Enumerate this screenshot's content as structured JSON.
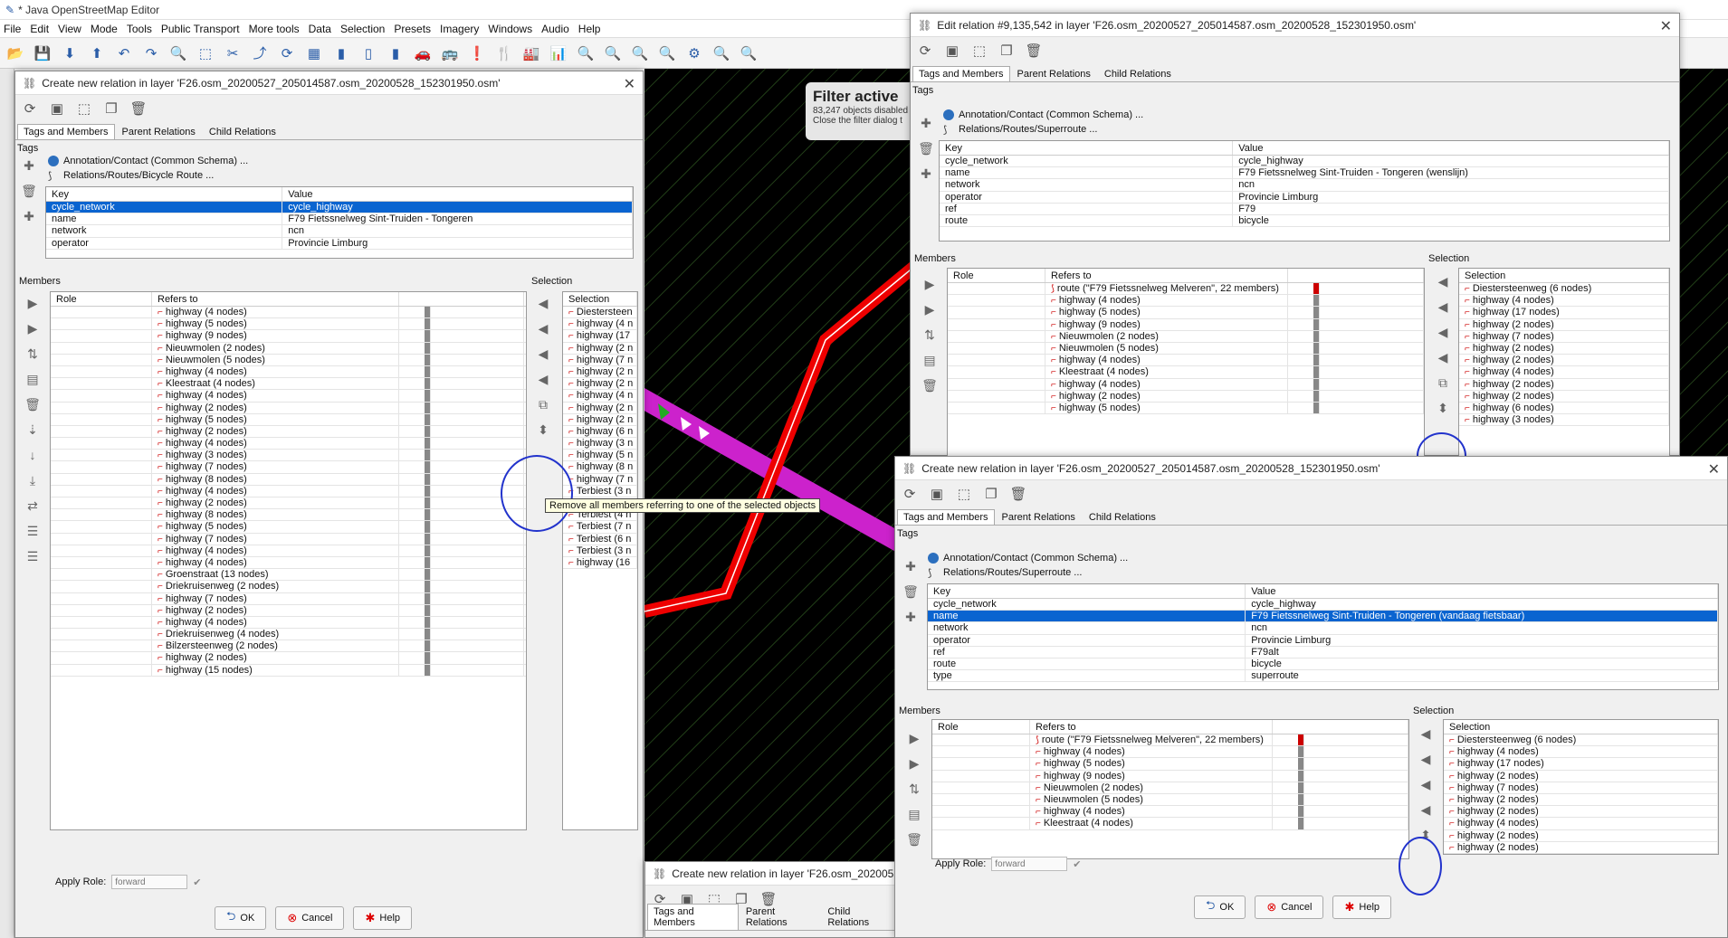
{
  "app": {
    "title": "* Java OpenStreetMap Editor"
  },
  "menu": [
    "File",
    "Edit",
    "View",
    "Mode",
    "Tools",
    "Public Transport",
    "More tools",
    "Data",
    "Selection",
    "Presets",
    "Imagery",
    "Windows",
    "Audio",
    "Help"
  ],
  "map": {
    "filter_title": "Filter active",
    "filter_line1": "83,247 objects disabled",
    "filter_line2": "Close the filter dialog t"
  },
  "dlg1": {
    "title": "Create new relation in layer 'F26.osm_20200527_205014587.osm_20200528_152301950.osm'",
    "tabs": [
      "Tags and Members",
      "Parent Relations",
      "Child Relations"
    ],
    "tags_label": "Tags",
    "preset1": "Annotation/Contact (Common Schema) ...",
    "preset2": "Relations/Routes/Bicycle Route ...",
    "key_header": "Key",
    "value_header": "Value",
    "tags": [
      [
        "cycle_network",
        "cycle_highway"
      ],
      [
        "name",
        "F79 Fietssnelweg Sint-Truiden - Tongeren"
      ],
      [
        "network",
        "ncn"
      ],
      [
        "operator",
        "Provincie Limburg"
      ]
    ],
    "members_label": "Members",
    "role_header": "Role",
    "refers_header": "Refers to",
    "members": [
      "highway (4 nodes)",
      "highway (5 nodes)",
      "highway (9 nodes)",
      "Nieuwmolen (2 nodes)",
      "Nieuwmolen (5 nodes)",
      "highway (4 nodes)",
      "Kleestraat (4 nodes)",
      "highway (4 nodes)",
      "highway (2 nodes)",
      "highway (5 nodes)",
      "highway (2 nodes)",
      "highway (4 nodes)",
      "highway (3 nodes)",
      "highway (7 nodes)",
      "highway (8 nodes)",
      "highway (4 nodes)",
      "highway (2 nodes)",
      "highway (8 nodes)",
      "highway (5 nodes)",
      "highway (7 nodes)",
      "highway (4 nodes)",
      "highway (4 nodes)",
      "Groenstraat (13 nodes)",
      "Driekruisenweg (2 nodes)",
      "highway (7 nodes)",
      "highway (2 nodes)",
      "highway (4 nodes)",
      "Driekruisenweg (4 nodes)",
      "Bilzersteenweg (2 nodes)",
      "highway (2 nodes)",
      "highway (15 nodes)"
    ],
    "selection_label": "Selection",
    "selection_header": "Selection",
    "selection": [
      "Diestersteen",
      "highway (4 n",
      "highway (17",
      "highway (2 n",
      "highway (7 n",
      "highway (2 n",
      "highway (2 n",
      "highway (4 n",
      "highway (2 n",
      "highway (2 n",
      "highway (6 n",
      "highway (3 n",
      "highway (5 n",
      "highway (8 n",
      "highway (7 n",
      "Terbiest (3 n",
      "Terbiest (5 n",
      "Terbiest (4 n",
      "Terbiest (7 n",
      "Terbiest (6 n",
      "Terbiest (3 n",
      "highway (16"
    ],
    "apply_role": "Apply Role:",
    "apply_placeholder": "forward",
    "ok": "OK",
    "cancel": "Cancel",
    "help": "Help"
  },
  "tooltip": "Remove all members referring to one of the selected objects",
  "dlg2": {
    "title": "Edit relation #9,135,542 in layer 'F26.osm_20200527_205014587.osm_20200528_152301950.osm'",
    "tabs": [
      "Tags and Members",
      "Parent Relations",
      "Child Relations"
    ],
    "tags_label": "Tags",
    "preset1": "Annotation/Contact (Common Schema) ...",
    "preset2": "Relations/Routes/Superroute ...",
    "key_header": "Key",
    "value_header": "Value",
    "tags": [
      [
        "cycle_network",
        "cycle_highway"
      ],
      [
        "name",
        "F79 Fietssnelweg Sint-Truiden - Tongeren (wenslijn)"
      ],
      [
        "network",
        "ncn"
      ],
      [
        "operator",
        "Provincie Limburg"
      ],
      [
        "ref",
        "F79"
      ],
      [
        "route",
        "bicycle"
      ]
    ],
    "members_label": "Members",
    "role_header": "Role",
    "refers_header": "Refers to",
    "members": [
      "route (\"F79 Fietssnelweg Melveren\", 22 members)",
      "highway (4 nodes)",
      "highway (5 nodes)",
      "highway (9 nodes)",
      "Nieuwmolen (2 nodes)",
      "Nieuwmolen (5 nodes)",
      "highway (4 nodes)",
      "Kleestraat (4 nodes)",
      "highway (4 nodes)",
      "highway (2 nodes)",
      "highway (5 nodes)"
    ],
    "selection_label": "Selection",
    "selection_header": "Selection",
    "selection": [
      "Diestersteenweg (6 nodes)",
      "highway (4 nodes)",
      "highway (17 nodes)",
      "highway (2 nodes)",
      "highway (7 nodes)",
      "highway (2 nodes)",
      "highway (2 nodes)",
      "highway (4 nodes)",
      "highway (2 nodes)",
      "highway (2 nodes)",
      "highway (6 nodes)",
      "highway (3 nodes)"
    ],
    "apply_role": "Apply Role:",
    "apply_placeholder": "forward"
  },
  "dlg3": {
    "title": "Create new relation in layer 'F26.osm_20200527_205014587.osm_20200528_152301950.osm'",
    "tabs": [
      "Tags and Members",
      "Parent Relations",
      "Child Relations"
    ],
    "tags_label": "Tags",
    "preset1": "Annotation/Contact (Common Schema) ...",
    "preset2": "Relations/Routes/Superroute ...",
    "key_header": "Key",
    "value_header": "Value",
    "tags": [
      [
        "cycle_network",
        "cycle_highway"
      ],
      [
        "name",
        "F79 Fietssnelweg Sint-Truiden - Tongeren (vandaag fietsbaar)"
      ],
      [
        "network",
        "ncn"
      ],
      [
        "operator",
        "Provincie Limburg"
      ],
      [
        "ref",
        "F79alt"
      ],
      [
        "route",
        "bicycle"
      ],
      [
        "type",
        "superroute"
      ]
    ],
    "members_label": "Members",
    "role_header": "Role",
    "refers_header": "Refers to",
    "members": [
      "route (\"F79 Fietssnelweg Melveren\", 22 members)",
      "highway (4 nodes)",
      "highway (5 nodes)",
      "highway (9 nodes)",
      "Nieuwmolen (2 nodes)",
      "Nieuwmolen (5 nodes)",
      "highway (4 nodes)",
      "Kleestraat (4 nodes)"
    ],
    "selection_label": "Selection",
    "selection_header": "Selection",
    "selection": [
      "Diestersteenweg (6 nodes)",
      "highway (4 nodes)",
      "highway (17 nodes)",
      "highway (2 nodes)",
      "highway (7 nodes)",
      "highway (2 nodes)",
      "highway (2 nodes)",
      "highway (4 nodes)",
      "highway (2 nodes)",
      "highway (2 nodes)"
    ],
    "apply_role": "Apply Role:",
    "apply_placeholder": "forward",
    "ok": "OK",
    "cancel": "Cancel",
    "help": "Help"
  },
  "dlg4": {
    "title": "Create new relation in layer 'F26.osm_20200527",
    "tabs": [
      "Tags and Members",
      "Parent Relations",
      "Child Relations"
    ]
  }
}
